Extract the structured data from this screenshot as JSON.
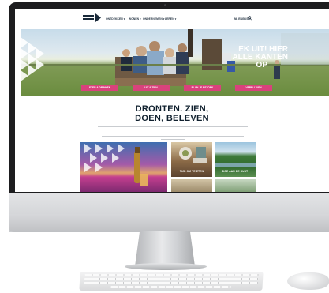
{
  "site": {
    "nav": {
      "items": [
        "ONTDEKKEN",
        "WONEN",
        "ONDERNEMEN",
        "LEREN"
      ],
      "language": "NL ENGLISH"
    },
    "hero": {
      "title_lines": [
        "EK UIT! HIER",
        "ALLE KANTEN",
        "OP"
      ],
      "buttons": [
        "ETEN & DRINKEN",
        "UIT & ZIEN",
        "PLAN JE BEZOEK",
        "VERBLIJVEN"
      ]
    },
    "intro": {
      "title_lines": [
        "DRONTEN. ZIEN,",
        "DOEN, BELEVEN"
      ]
    },
    "tiles": [
      {
        "label": ""
      },
      {
        "label": "TIJD OM TE ETEN"
      },
      {
        "label": "DOE AAN DE KUST"
      },
      {
        "label": ""
      },
      {
        "label": ""
      }
    ]
  },
  "colors": {
    "accent": "#d9427c",
    "nav_text": "#1a2a3a",
    "title_text": "#10202e",
    "bezel": "#1d1d1f"
  },
  "icons": {
    "logo": "dronten-logo-icon",
    "search": "search-icon",
    "hero_shape": "triangle-pattern-icon"
  }
}
